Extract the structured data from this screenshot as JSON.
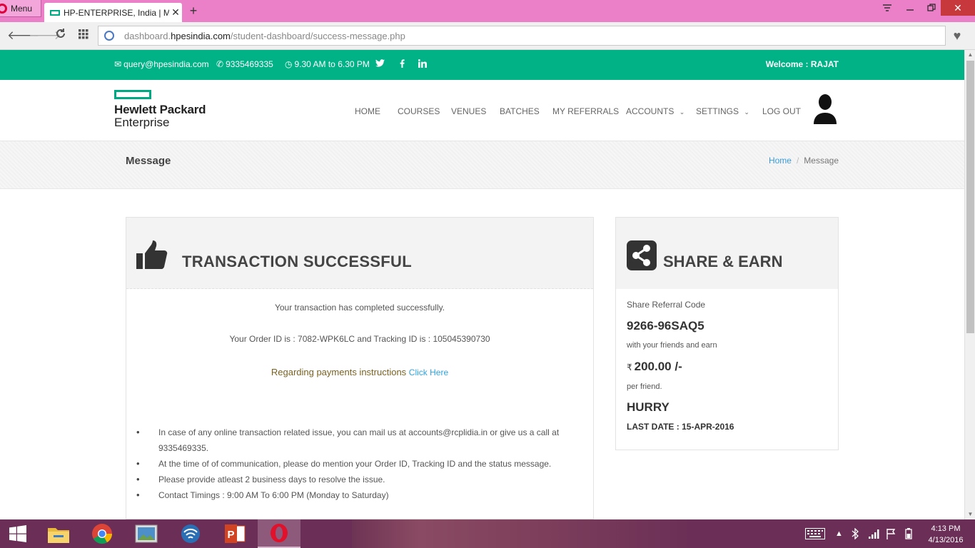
{
  "browser": {
    "menu_label": "Menu",
    "tab_title": "HP-ENTERPRISE, India | Me",
    "new_tab": "+",
    "url_scheme_path_prefix": "dashboard.",
    "url_host": "hpesindia.com",
    "url_path": "/student-dashboard/success-message.php"
  },
  "topbar": {
    "email": "query@hpesindia.com",
    "phone": "9335469335",
    "hours": "9.30 AM to 6.30 PM",
    "social": [
      "twitter-icon",
      "facebook-icon",
      "linkedin-icon"
    ],
    "welcome": "Welcome : RAJAT"
  },
  "logo": {
    "line1": "Hewlett Packard",
    "line2": "Enterprise"
  },
  "nav": {
    "home": "HOME",
    "courses": "COURSES",
    "venues": "VENUES",
    "batches": "BATCHES",
    "referrals": "MY REFERRALS",
    "accounts": "ACCOUNTS",
    "settings": "SETTINGS",
    "logout": "LOG OUT"
  },
  "title_bar": {
    "title": "Message",
    "breadcrumb_home": "Home",
    "breadcrumb_sep": "/",
    "breadcrumb_current": "Message"
  },
  "transaction": {
    "title": "TRANSACTION SUCCESSFUL",
    "line1": "Your transaction has completed successfully.",
    "line2": "Your Order ID is : 7082-WPK6LC and Tracking ID is : 105045390730",
    "payments_text": "Regarding payments instructions ",
    "click_here": "Click Here",
    "notes": [
      "In case of any online transaction related issue, you can mail us at accounts@rcplidia.in or give us a call at 9335469335.",
      "At the time of of communication, please do mention your Order ID, Tracking ID and the status message.",
      "Please provide atleast 2 business days to resolve the issue.",
      "Contact Timings : 9:00 AM To 6:00 PM (Monday to Saturday)"
    ]
  },
  "share": {
    "title": "SHARE & EARN",
    "label": "Share Referral Code",
    "code": "9266-96SAQ5",
    "with_friends": "with your friends and earn",
    "currency": "₹",
    "amount": "200.00 /-",
    "per_friend": "per friend.",
    "hurry": "HURRY",
    "last_date": "LAST DATE : 15-APR-2016"
  },
  "taskbar": {
    "apps": [
      "file-explorer-icon",
      "chrome-icon",
      "photos-icon",
      "network-icon",
      "powerpoint-icon",
      "opera-icon"
    ],
    "time": "4:13 PM",
    "date": "4/13/2016"
  },
  "colors": {
    "brand_green": "#01b286",
    "tab_bar_pink": "#ec80c8",
    "taskbar_purple": "#6b2f57",
    "link_blue": "#2fa3df"
  }
}
